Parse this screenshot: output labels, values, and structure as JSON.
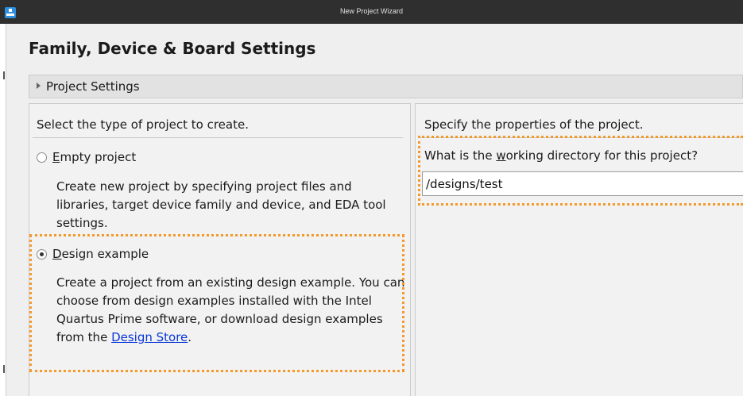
{
  "window": {
    "title": "New Project Wizard"
  },
  "page": {
    "title": "Family, Device & Board Settings"
  },
  "section": {
    "label": "Project Settings"
  },
  "left": {
    "heading": "Select the type of project to create.",
    "empty_option": {
      "label_mnemonic": "E",
      "label_rest": "mpty project",
      "selected": false,
      "description": "Create new project by specifying project files and libraries, target device family and device, and EDA tool settings."
    },
    "design_option": {
      "label_mnemonic": "D",
      "label_rest": "esign example",
      "selected": true,
      "description": "Create a project from an existing design example. You can choose from design examples installed with the Intel Quartus Prime software, or download design examples from the ",
      "link_text": "Design Store",
      "description_end": "."
    }
  },
  "right": {
    "heading": "Specify the properties of the project.",
    "question_prefix": "What is the ",
    "question_mnemonic": "w",
    "question_suffix": "orking directory for this project?",
    "directory_value": "/designs/test"
  },
  "colors": {
    "highlight": "#f39a2b",
    "link": "#0a36d8",
    "titlebar": "#2f2f2f",
    "app_icon": "#2d8fe0"
  }
}
